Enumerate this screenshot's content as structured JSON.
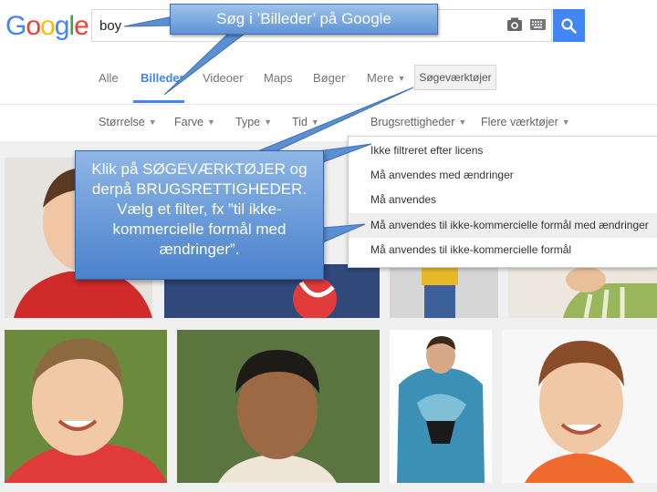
{
  "header": {
    "logo_letters": [
      {
        "char": "G",
        "color": "#4285f4"
      },
      {
        "char": "o",
        "color": "#ea4335"
      },
      {
        "char": "o",
        "color": "#fbbc05"
      },
      {
        "char": "g",
        "color": "#4285f4"
      },
      {
        "char": "l",
        "color": "#34a853"
      },
      {
        "char": "e",
        "color": "#ea4335"
      }
    ],
    "search_value": "boy",
    "icons": {
      "camera": "camera-icon",
      "keyboard": "keyboard-icon",
      "search": "search-icon"
    }
  },
  "tabs": [
    {
      "label": "Alle",
      "active": false
    },
    {
      "label": "Billeder",
      "active": true
    },
    {
      "label": "Videoer",
      "active": false
    },
    {
      "label": "Maps",
      "active": false
    },
    {
      "label": "Bøger",
      "active": false
    },
    {
      "label": "Mere",
      "active": false
    }
  ],
  "tools_button_label": "Søgeværktøjer",
  "filters": [
    "Størrelse",
    "Farve",
    "Type",
    "Tid",
    "Brugsrettigheder",
    "Flere værktøjer"
  ],
  "usage_rights_menu": {
    "items": [
      "Ikke filtreret efter licens",
      "Må anvendes med ændringer",
      "Må anvendes",
      "Må anvendes til ikke-kommercielle formål med ændringer",
      "Må anvendes til ikke-kommercielle formål"
    ],
    "highlighted_index": 3
  },
  "callouts": {
    "top": "Søg i ’Billeder’ på Google",
    "main_lines": [
      "Klik på SØGEVÆRKTØJER og",
      "derpå BRUGSRETTIGHEDER.",
      "Vælg et filter, fx ”til ikke-",
      "kommercielle formål med",
      "ændringer”."
    ]
  },
  "colors": {
    "accent_blue": "#4285f4",
    "callout_blue": "#5b8fd4"
  }
}
